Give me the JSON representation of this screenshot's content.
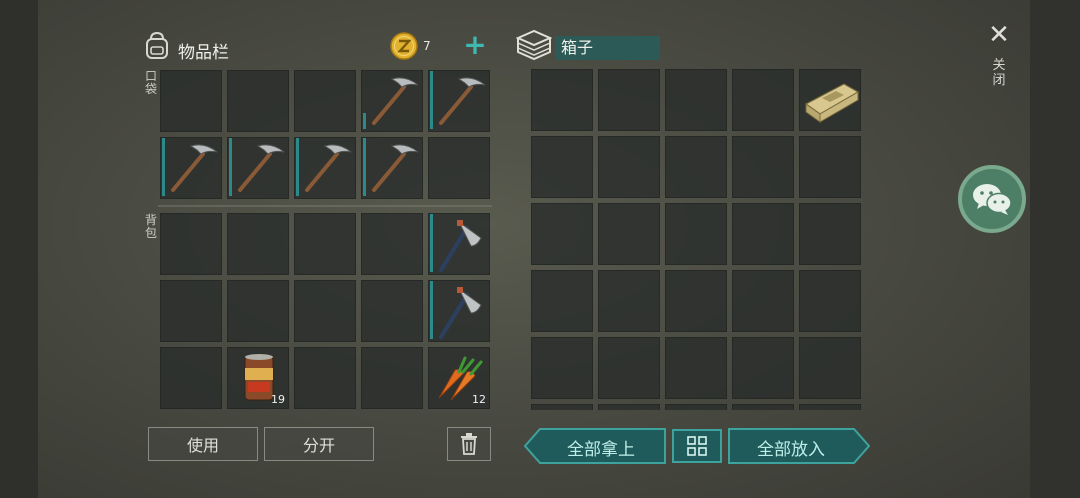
{
  "inventory": {
    "title": "物品栏",
    "coins": "7",
    "add_symbol": "+",
    "pocket_label": "口袋",
    "backpack_label": "背包",
    "food_count": "19",
    "carrot_count": "12"
  },
  "chest": {
    "title": "箱子"
  },
  "actions": {
    "use": "使用",
    "split": "分开",
    "take_all": "全部拿上",
    "put_all": "全部放入"
  },
  "close": {
    "symbol": "✕",
    "label": "关闭"
  },
  "colors": {
    "accent_teal": "#3fa39d",
    "durability": "#2d8a8a",
    "coin_gold": "#e0b230",
    "wechat_green": "#4d7f66"
  },
  "icons": [
    "backpack-icon",
    "coin-icon",
    "chest-icon",
    "pickaxe-icon",
    "hatchet-icon",
    "canned-food-icon",
    "carrot-icon",
    "crate-icon",
    "trash-icon",
    "grid-sort-icon",
    "close-icon",
    "wechat-icon"
  ]
}
